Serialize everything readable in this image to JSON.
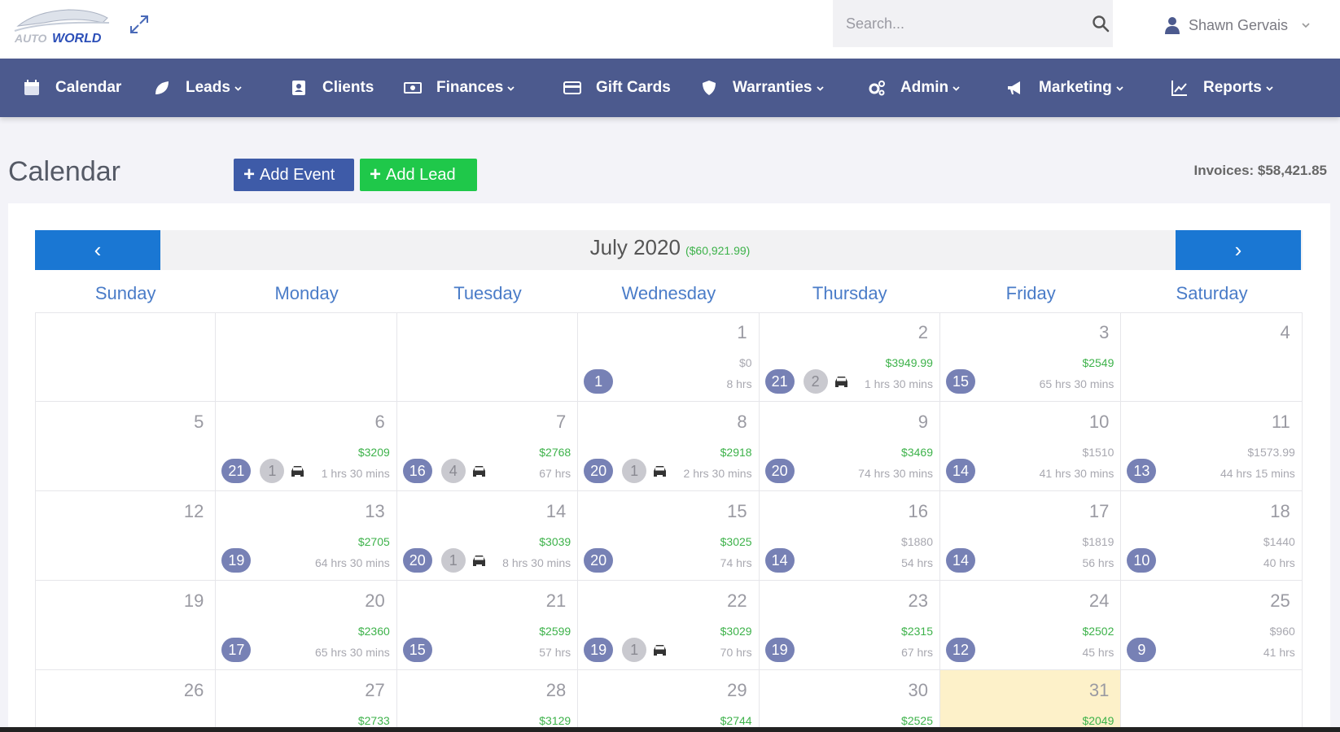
{
  "brand": {
    "logo_text": "AUTO WORLD"
  },
  "search": {
    "placeholder": "Search..."
  },
  "user": {
    "name": "Shawn Gervais"
  },
  "nav": [
    {
      "label": "Calendar",
      "icon": "calendar-icon"
    },
    {
      "label": "Leads",
      "icon": "leaf-icon",
      "dropdown": true
    },
    {
      "label": "Clients",
      "icon": "address-book-icon"
    },
    {
      "label": "Finances",
      "icon": "money-icon",
      "dropdown": true
    },
    {
      "label": "Gift Cards",
      "icon": "credit-card-icon"
    },
    {
      "label": "Warranties",
      "icon": "shield-icon",
      "dropdown": true
    },
    {
      "label": "Admin",
      "icon": "cogs-icon",
      "dropdown": true
    },
    {
      "label": "Marketing",
      "icon": "bullhorn-icon",
      "dropdown": true
    },
    {
      "label": "Reports",
      "icon": "chart-icon",
      "dropdown": true
    }
  ],
  "page": {
    "title": "Calendar",
    "add_event": "Add Event",
    "add_lead": "Add Lead",
    "invoices": "Invoices: $58,421.85"
  },
  "calendar": {
    "month": "July 2020",
    "month_total": "($60,921.99)",
    "prev": "‹",
    "next": "›",
    "weekdays": [
      "Sunday",
      "Monday",
      "Tuesday",
      "Wednesday",
      "Thursday",
      "Friday",
      "Saturday"
    ],
    "weeks": [
      [
        null,
        null,
        null,
        {
          "day": "1",
          "amount": "$0",
          "amount_green": false,
          "hours": "8 hrs",
          "badge": "1"
        },
        {
          "day": "2",
          "amount": "$3949.99",
          "amount_green": true,
          "hours": "1 hrs 30 mins",
          "badge": "21",
          "badge2": "2",
          "car": true
        },
        {
          "day": "3",
          "amount": "$2549",
          "amount_green": true,
          "hours": "65 hrs 30 mins",
          "badge": "15"
        },
        {
          "day": "4"
        }
      ],
      [
        {
          "day": "5"
        },
        {
          "day": "6",
          "amount": "$3209",
          "amount_green": true,
          "hours": "1 hrs 30 mins",
          "badge": "21",
          "badge2": "1",
          "car": true
        },
        {
          "day": "7",
          "amount": "$2768",
          "amount_green": true,
          "hours": "67 hrs",
          "badge": "16",
          "badge2": "4",
          "car": true
        },
        {
          "day": "8",
          "amount": "$2918",
          "amount_green": true,
          "hours": "2 hrs 30 mins",
          "badge": "20",
          "badge2": "1",
          "car": true
        },
        {
          "day": "9",
          "amount": "$3469",
          "amount_green": true,
          "hours": "74 hrs 30 mins",
          "badge": "20"
        },
        {
          "day": "10",
          "amount": "$1510",
          "amount_green": false,
          "hours": "41 hrs 30 mins",
          "badge": "14"
        },
        {
          "day": "11",
          "amount": "$1573.99",
          "amount_green": false,
          "hours": "44 hrs 15 mins",
          "badge": "13"
        }
      ],
      [
        {
          "day": "12"
        },
        {
          "day": "13",
          "amount": "$2705",
          "amount_green": true,
          "hours": "64 hrs 30 mins",
          "badge": "19"
        },
        {
          "day": "14",
          "amount": "$3039",
          "amount_green": true,
          "hours": "8 hrs 30 mins",
          "badge": "20",
          "badge2": "1",
          "car": true
        },
        {
          "day": "15",
          "amount": "$3025",
          "amount_green": true,
          "hours": "74 hrs",
          "badge": "20"
        },
        {
          "day": "16",
          "amount": "$1880",
          "amount_green": false,
          "hours": "54 hrs",
          "badge": "14"
        },
        {
          "day": "17",
          "amount": "$1819",
          "amount_green": false,
          "hours": "56 hrs",
          "badge": "14"
        },
        {
          "day": "18",
          "amount": "$1440",
          "amount_green": false,
          "hours": "40 hrs",
          "badge": "10"
        }
      ],
      [
        {
          "day": "19"
        },
        {
          "day": "20",
          "amount": "$2360",
          "amount_green": true,
          "hours": "65 hrs 30 mins",
          "badge": "17"
        },
        {
          "day": "21",
          "amount": "$2599",
          "amount_green": true,
          "hours": "57 hrs",
          "badge": "15"
        },
        {
          "day": "22",
          "amount": "$3029",
          "amount_green": true,
          "hours": "70 hrs",
          "badge": "19",
          "badge2": "1",
          "car": true
        },
        {
          "day": "23",
          "amount": "$2315",
          "amount_green": true,
          "hours": "67 hrs",
          "badge": "19"
        },
        {
          "day": "24",
          "amount": "$2502",
          "amount_green": true,
          "hours": "45 hrs",
          "badge": "12"
        },
        {
          "day": "25",
          "amount": "$960",
          "amount_green": false,
          "hours": "41 hrs",
          "badge": "9"
        }
      ],
      [
        {
          "day": "26"
        },
        {
          "day": "27",
          "amount": "$2733",
          "amount_green": true
        },
        {
          "day": "28",
          "amount": "$3129",
          "amount_green": true
        },
        {
          "day": "29",
          "amount": "$2744",
          "amount_green": true
        },
        {
          "day": "30",
          "amount": "$2525",
          "amount_green": true
        },
        {
          "day": "31",
          "amount": "$2049",
          "amount_green": true,
          "today": true
        },
        null
      ]
    ]
  },
  "colors": {
    "nav_bg": "#4c5a8e",
    "primary_button": "#3e5ba8",
    "success_button": "#1fc84a",
    "month_nav": "#1a77d3",
    "badge": "#7781b5",
    "today": "#fdf1c9",
    "amount_green": "#3db24a"
  }
}
